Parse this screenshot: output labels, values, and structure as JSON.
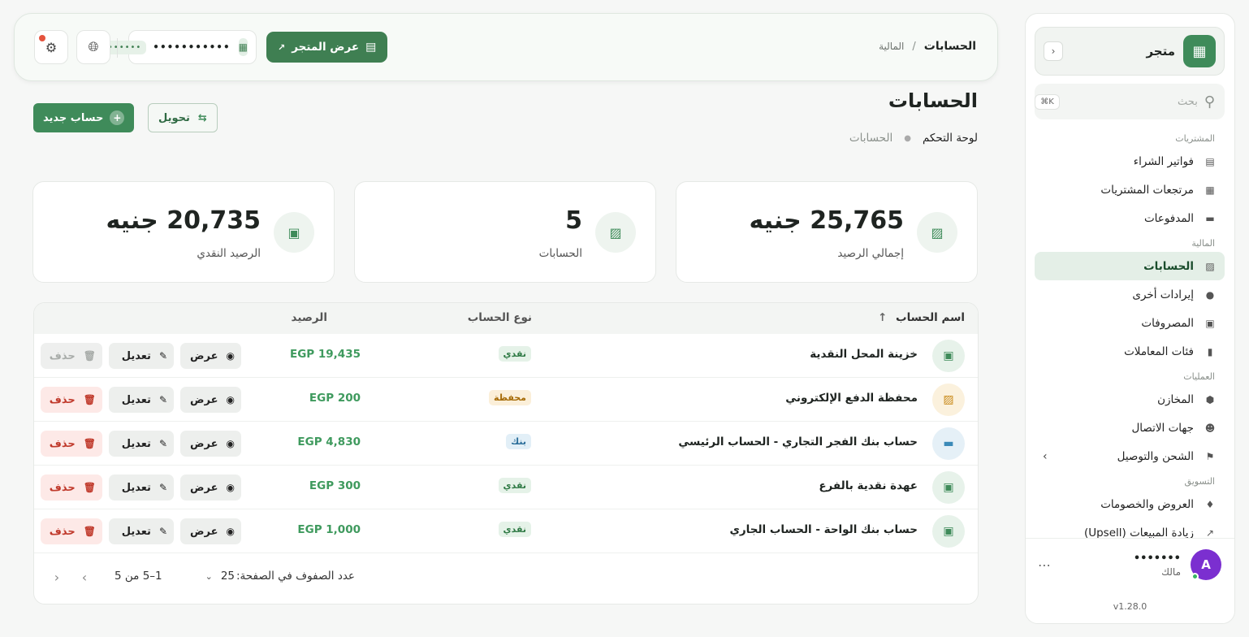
{
  "sidebar": {
    "store_name": "متجر",
    "search_placeholder": "بحث",
    "search_shortcut": "⌘K",
    "sections": [
      {
        "title": "المشتريات",
        "items": [
          {
            "label": "فواتير الشراء",
            "icon": "invoice-icon"
          },
          {
            "label": "مرتجعات المشتريات",
            "icon": "return-icon"
          },
          {
            "label": "المدفوعات",
            "icon": "payment-icon"
          }
        ]
      },
      {
        "title": "المالية",
        "items": [
          {
            "label": "الحسابات",
            "icon": "wallet-icon",
            "active": true
          },
          {
            "label": "إيرادات أخرى",
            "icon": "moneybag-icon"
          },
          {
            "label": "المصروفات",
            "icon": "expense-icon"
          },
          {
            "label": "فئات المعاملات",
            "icon": "tag-icon"
          }
        ]
      },
      {
        "title": "العمليات",
        "items": [
          {
            "label": "المخازن",
            "icon": "box-icon"
          },
          {
            "label": "جهات الاتصال",
            "icon": "contacts-icon"
          },
          {
            "label": "الشحن والتوصيل",
            "icon": "shipping-icon",
            "has_chevron": true
          }
        ]
      },
      {
        "title": "التسويق",
        "items": [
          {
            "label": "العروض والخصومات",
            "icon": "discount-icon"
          },
          {
            "label": "زيادة المبيعات (Upsell)",
            "icon": "trend-icon"
          }
        ]
      }
    ],
    "user": {
      "initial": "A",
      "name": "•••••••",
      "role": "مالك"
    },
    "version": "v1.28.0"
  },
  "topbar": {
    "breadcrumb_current": "الحسابات",
    "breadcrumb_separator": "/",
    "breadcrumb_parent": "المالية",
    "view_store_label": "عرض المتجر",
    "branch_name": "•••••••••••",
    "branch_tag": "••••••"
  },
  "page": {
    "title": "الحسابات",
    "crumb_home": "لوحة التحكم",
    "crumb_current": "الحسابات",
    "new_account_label": "حساب جديد",
    "transfer_label": "تحويل"
  },
  "stats": [
    {
      "value": "25,765 جنيه",
      "label": "إجمالي الرصيد"
    },
    {
      "value": "5",
      "label": "الحسابات"
    },
    {
      "value": "20,735 جنيه",
      "label": "الرصيد النقدي"
    }
  ],
  "table": {
    "headers": {
      "name": "اسم الحساب",
      "sort_indicator": "↑",
      "type": "نوع الحساب",
      "balance": "الرصيد"
    },
    "actions": {
      "view": "عرض",
      "edit": "تعديل",
      "delete": "حذف"
    },
    "rows": [
      {
        "name": "خزينة المحل النقدية",
        "type": "نقدي",
        "kind": "cash",
        "balance": "EGP 19,435",
        "delete_disabled": true
      },
      {
        "name": "محفظة الدفع الإلكتروني",
        "type": "محفظة",
        "kind": "wallet",
        "balance": "EGP 200",
        "delete_disabled": false
      },
      {
        "name": "حساب بنك الفجر التجاري - الحساب الرئيسي",
        "type": "بنك",
        "kind": "bank",
        "balance": "EGP 4,830",
        "delete_disabled": false
      },
      {
        "name": "عهدة نقدية بالفرع",
        "type": "نقدي",
        "kind": "cash",
        "balance": "EGP 300",
        "delete_disabled": false
      },
      {
        "name": "حساب بنك الواحة - الحساب الجاري",
        "type": "نقدي",
        "kind": "cash",
        "balance": "EGP 1,000",
        "delete_disabled": false
      }
    ]
  },
  "pagination": {
    "rows_per_page_label": "عدد الصفوف في الصفحة:",
    "rows_per_page_value": "25",
    "range_text": "1–5 من 5"
  },
  "colors": {
    "brand": "#3f8b5a",
    "danger": "#c0392b",
    "balance": "#3f9a5e"
  }
}
